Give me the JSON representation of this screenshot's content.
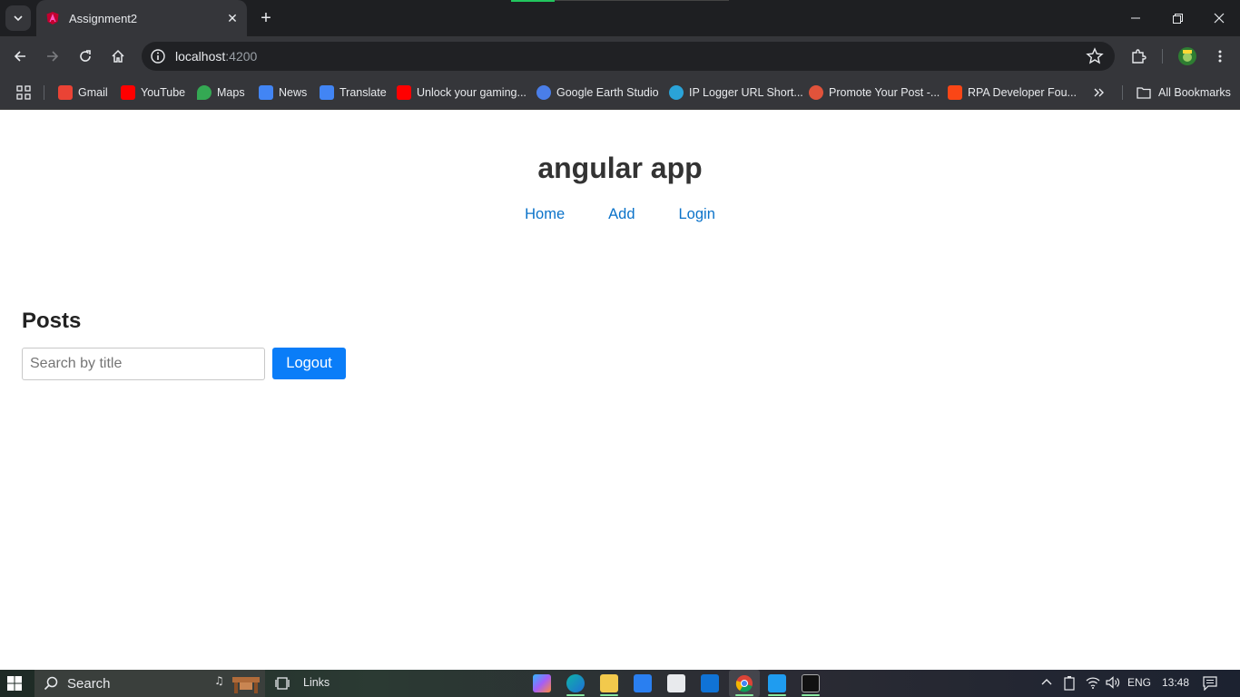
{
  "browser": {
    "tab_title": "Assignment2",
    "url_host": "localhost",
    "url_port": ":4200",
    "bookmarks": [
      {
        "label": "Gmail",
        "icon": "gmail-icon",
        "color": "#ea4335"
      },
      {
        "label": "YouTube",
        "icon": "youtube-icon",
        "color": "#ff0000"
      },
      {
        "label": "Maps",
        "icon": "maps-icon",
        "color": "#34a853"
      },
      {
        "label": "News",
        "icon": "news-icon",
        "color": "#4285f4"
      },
      {
        "label": "Translate",
        "icon": "translate-icon",
        "color": "#4285f4"
      },
      {
        "label": "Unlock your gaming...",
        "icon": "youtube-icon",
        "color": "#ff0000"
      },
      {
        "label": "Google Earth Studio",
        "icon": "earth-icon",
        "color": "#4a7ee8"
      },
      {
        "label": "IP Logger URL Short...",
        "icon": "iplogger-icon",
        "color": "#2aa3d8"
      },
      {
        "label": "Promote Your Post -...",
        "icon": "rocket-icon",
        "color": "#e0533b"
      },
      {
        "label": "RPA Developer Fou...",
        "icon": "uipath-icon",
        "color": "#fa4616"
      }
    ],
    "all_bookmarks_label": "All Bookmarks"
  },
  "app": {
    "title": "angular app",
    "nav": [
      "Home",
      "Add",
      "Login"
    ],
    "posts_heading": "Posts",
    "search_placeholder": "Search by title",
    "logout_label": "Logout"
  },
  "taskbar": {
    "search_label": "Search",
    "links_label": "Links",
    "language": "ENG",
    "time": "13:48"
  }
}
